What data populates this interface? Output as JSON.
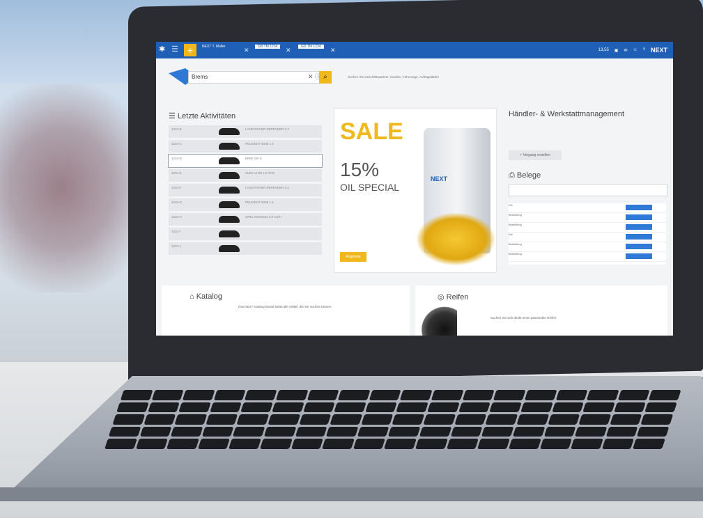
{
  "topbar": {
    "tab1": "NEXT T. Müller",
    "tab2": "GB TM 1234",
    "tab3": "GD TM 1234",
    "right_counter": "13,55",
    "logo": "NEXT"
  },
  "search": {
    "value": "Brems",
    "hint": "Suchen Sie Geschäftspartner, Kunden, Fahrzeuge, Auftragsdaten"
  },
  "activities": {
    "title": "Letzte Aktivitäten",
    "rows": [
      {
        "id": "1234-B",
        "text": "LAND ROVER DEFENDER 2.4"
      },
      {
        "id": "1234-C",
        "text": "PEUGEOT 5008 1.6"
      },
      {
        "id": "1234-D",
        "text": "BMW 320 d"
      },
      {
        "id": "1234-E",
        "text": "AUDI A4 B8 1.8 TFSI"
      },
      {
        "id": "1234-F",
        "text": "LAND ROVER DEFENDER 2.4"
      },
      {
        "id": "1234-G",
        "text": "PEUGEOT 5008 1.6"
      },
      {
        "id": "1234-H",
        "text": "OPEL INSIGNIA 2.0 CDTI"
      },
      {
        "id": "1234-I",
        "text": ""
      },
      {
        "id": "1234-J",
        "text": ""
      }
    ]
  },
  "sale": {
    "word": "SALE",
    "percent": "15%",
    "product": "OIL SPECIAL",
    "button": "Angebote",
    "can_brand": "NEXT"
  },
  "haendler": {
    "title": "Händler- & Werkstattmanagement",
    "button": "+ Vorgang erstellen"
  },
  "belege": {
    "title": "Belege",
    "rows": [
      "Kfz",
      "Bestellung",
      "Bestellung",
      "Kfz",
      "Bestellung",
      "Bestellung"
    ]
  },
  "katalog": {
    "title": "Katalog",
    "desc": "Das NEXT Katalog Modul bietet alle Artikel, die Sie suchen können."
  },
  "reifen": {
    "title": "Reifen",
    "desc": "Suchen Sie sich direkt einen passenden Reifen."
  }
}
